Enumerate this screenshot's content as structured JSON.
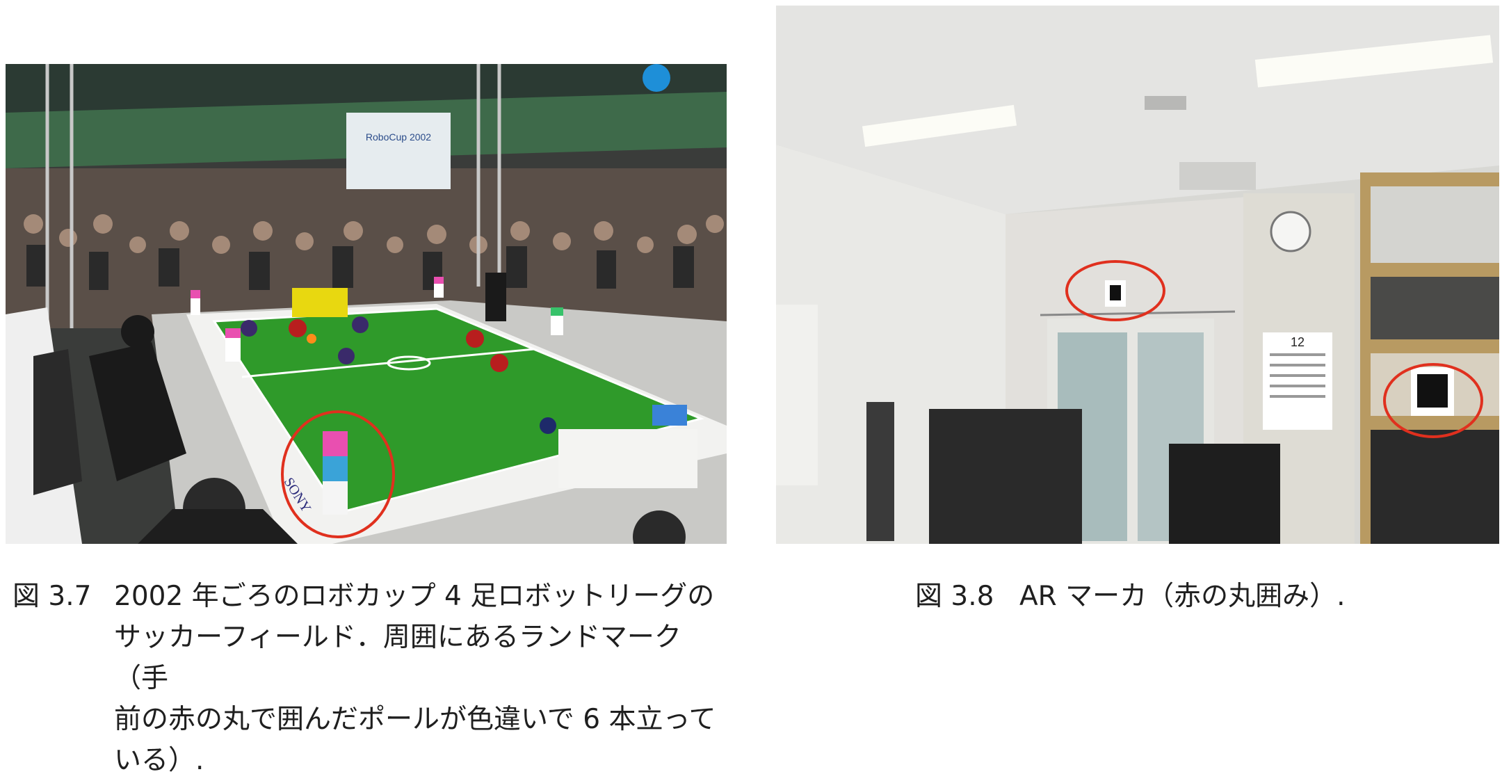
{
  "figures": [
    {
      "number": "図 3.7",
      "caption": "2002 年ごろのロボカップ 4 足ロボットリーグの\nサッカーフィールド．周囲にあるランドマーク（手\n前の赤の丸で囲んだポールが色違いで 6 本立って\nいる）.",
      "photo_banner": "RoboCup 2002",
      "photo_sponsor": "SONY"
    },
    {
      "number": "図 3.8",
      "caption": "AR マーカ（赤の丸囲み）.",
      "photo_calendar_month": "12"
    }
  ],
  "colors": {
    "highlight_circle": "#e0301e",
    "pitch": "#2f9a2a"
  }
}
